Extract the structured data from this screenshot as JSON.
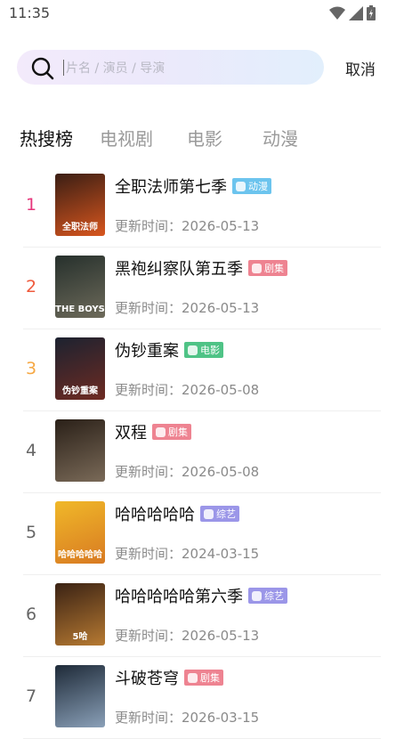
{
  "status": {
    "time": "11:35"
  },
  "search": {
    "placeholder": "片名 / 演员 / 导演",
    "cancel_label": "取消"
  },
  "tabs": [
    {
      "label": "热搜榜"
    },
    {
      "label": "电视剧"
    },
    {
      "label": "电影"
    },
    {
      "label": "动漫"
    }
  ],
  "update_label": "更新时间：",
  "items": [
    {
      "rank": "1",
      "rank_color": "#e6367b",
      "title": "全职法师第七季",
      "badge": "动漫",
      "badge_color": "#6cc4ee",
      "date": "2026-05-13",
      "poster_text": "全职法师",
      "poster_colors": [
        "#3a1e14",
        "#d8561e"
      ]
    },
    {
      "rank": "2",
      "rank_color": "#ef5a3c",
      "title": "黑袍纠察队第五季",
      "badge": "剧集",
      "badge_color": "#ee8391",
      "date": "2026-05-13",
      "poster_text": "THE BOYS",
      "poster_colors": [
        "#26302c",
        "#6d6a5a"
      ]
    },
    {
      "rank": "3",
      "rank_color": "#f6a844",
      "title": "伪钞重案",
      "badge": "电影",
      "badge_color": "#4fc386",
      "date": "2026-05-08",
      "poster_text": "伪钞重案",
      "poster_colors": [
        "#1c2230",
        "#6e2b22"
      ]
    },
    {
      "rank": "4",
      "rank_color": "#666666",
      "title": "双程",
      "badge": "剧集",
      "badge_color": "#ee8391",
      "date": "2026-05-08",
      "poster_text": "",
      "poster_colors": [
        "#2a2018",
        "#7a6a58"
      ]
    },
    {
      "rank": "5",
      "rank_color": "#666666",
      "title": "哈哈哈哈哈",
      "badge": "综艺",
      "badge_color": "#9b96e8",
      "date": "2024-03-15",
      "poster_text": "哈哈哈哈哈",
      "poster_colors": [
        "#f0b829",
        "#d87a22"
      ]
    },
    {
      "rank": "6",
      "rank_color": "#666666",
      "title": "哈哈哈哈哈第六季",
      "badge": "综艺",
      "badge_color": "#9b96e8",
      "date": "2026-05-13",
      "poster_text": "5哈",
      "poster_colors": [
        "#3a2214",
        "#b77a32"
      ]
    },
    {
      "rank": "7",
      "rank_color": "#666666",
      "title": "斗破苍穹",
      "badge": "剧集",
      "badge_color": "#ee8391",
      "date": "2026-03-15",
      "poster_text": "",
      "poster_colors": [
        "#1e2a38",
        "#8aa0b8"
      ]
    }
  ]
}
